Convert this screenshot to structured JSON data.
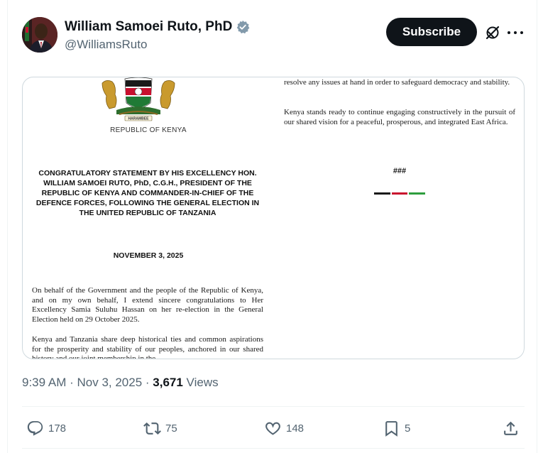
{
  "author": {
    "display_name": "William Samoei Ruto, PhD",
    "handle": "@WilliamsRuto",
    "verified": true
  },
  "header": {
    "subscribe_label": "Subscribe",
    "grok_icon": "grok-icon",
    "more_icon": "more-icon"
  },
  "document": {
    "seal_motto": "HARAMBEE",
    "republic": "REPUBLIC OF KENYA",
    "title": "CONGRATULATORY STATEMENT BY HIS EXCELLENCY HON. WILLIAM SAMOEI RUTO, PhD, C.G.H., PRESIDENT OF THE REPUBLIC OF KENYA AND COMMANDER-IN-CHIEF OF THE DEFENCE FORCES, FOLLOWING THE GENERAL ELECTION IN THE UNITED REPUBLIC OF TANZANIA",
    "date": "NOVEMBER 3, 2025",
    "paragraph_1": "On behalf of the Government and the people of the Republic of Kenya, and on my own behalf, I extend sincere congratulations to Her Excellency Samia Suluhu Hassan on her re-election in the General Election held on 29 October 2025.",
    "paragraph_2": "Kenya and Tanzania share deep historical ties and common aspirations for the prosperity and stability of our peoples, anchored in our shared history and our joint membership in the",
    "right_paragraph_1": "resolve any issues at hand in order to safeguard democracy and stability.",
    "right_paragraph_2": "Kenya stands ready to continue engaging constructively in the pursuit of our shared vision for a peaceful, prosperous, and integrated East Africa.",
    "end_mark": "###",
    "flag_colors": [
      "#1a1a1a",
      "#c8102e",
      "#2e9e3e"
    ]
  },
  "meta": {
    "time": "9:39 AM",
    "separator": " · ",
    "date": "Nov 3, 2025",
    "views_count": "3,671",
    "views_label": " Views"
  },
  "actions": {
    "replies": "178",
    "reposts": "75",
    "likes": "148",
    "bookmarks": "5"
  },
  "colors": {
    "text_primary": "#0f1419",
    "text_secondary": "#536471",
    "verified_blue": "#829aab",
    "border": "#cfd9de"
  }
}
